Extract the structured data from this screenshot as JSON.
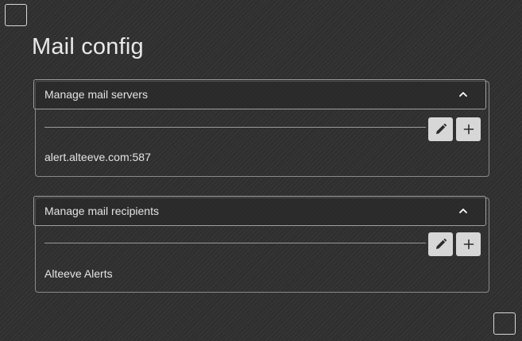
{
  "page": {
    "title": "Mail config"
  },
  "mail_servers": {
    "header_label": "Manage mail servers",
    "items": [
      "alert.alteeve.com:587"
    ]
  },
  "mail_recipients": {
    "header_label": "Manage mail recipients",
    "items": [
      "Alteeve Alerts"
    ]
  },
  "icons": {
    "collapse": "chevron-up-icon",
    "edit": "pencil-icon",
    "add": "plus-icon"
  },
  "colors": {
    "background": "#2f2f2f",
    "text": "#e6e6e6",
    "button_bg": "#d7d7d7",
    "button_icon": "#2b2b2b",
    "border": "#8a8a8a"
  }
}
